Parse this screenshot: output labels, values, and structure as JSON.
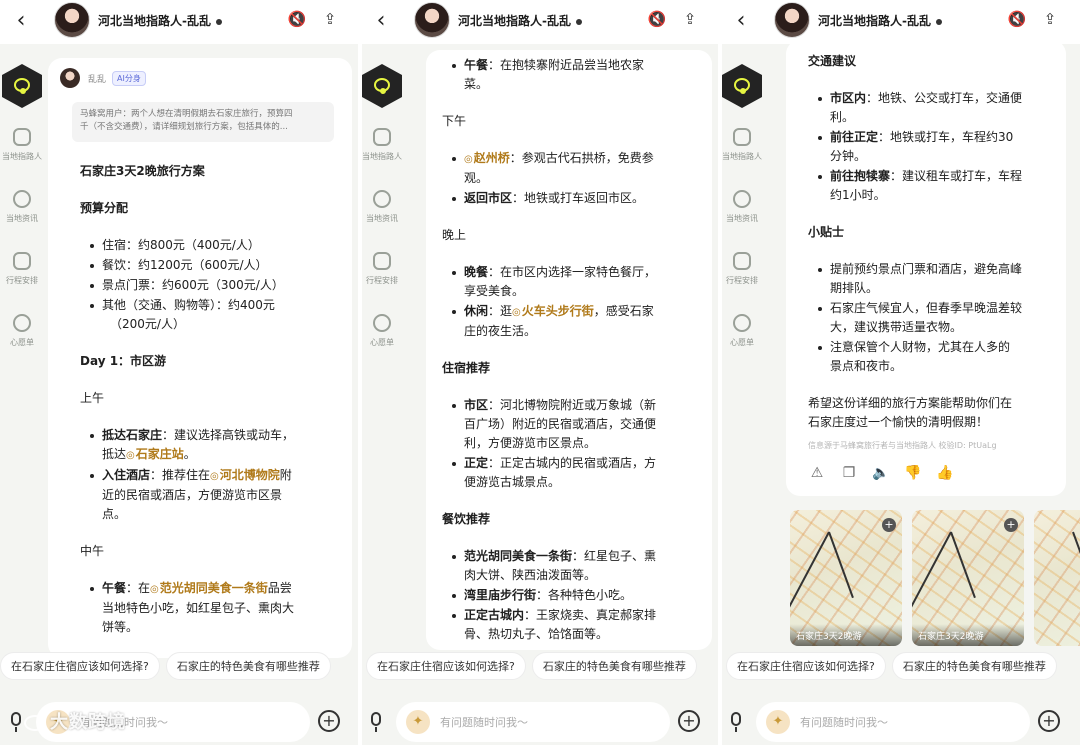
{
  "header": {
    "title": "河北当地指路人-乱乱",
    "back_icon": "chevron-left-icon",
    "mute_icon": "speaker-mute-icon",
    "share_icon": "share-icon"
  },
  "sidebar": {
    "items": [
      {
        "label": "当地指路人",
        "icon": "guide-icon"
      },
      {
        "label": "当地资讯",
        "icon": "news-icon"
      },
      {
        "label": "行程安排",
        "icon": "itinerary-icon"
      },
      {
        "label": "心愿单",
        "icon": "wishlist-icon"
      }
    ]
  },
  "message": {
    "sender": "乱乱",
    "badge": "AI分身",
    "quote_line1": "马蜂窝用户：两个人想在清明假期去石家庄旅行，预算四",
    "quote_line2": "千（不含交通费），请详细规划旅行方案，包括具体的..."
  },
  "panel1": {
    "title": "石家庄3天2晚旅行方案",
    "budget_heading": "预算分配",
    "budget": [
      "住宿：约800元（400元/人）",
      "餐饮：约1200元（600元/人）",
      "景点门票：约600元（300元/人）",
      "其他（交通、购物等）：约400元"
    ],
    "budget_last_cont": "（200元/人）",
    "day1": "Day 1：市区游",
    "morning": "上午",
    "m1_bold": "抵达石家庄",
    "m1_text": "：建议选择高铁或动车，",
    "m1_text2": "抵达",
    "m1_loc": "石家庄站",
    "m1_end": "。",
    "m2_bold": "入住酒店",
    "m2_text": "：推荐住在",
    "m2_loc": "河北博物院",
    "m2_text2": "附",
    "m2_text3": "近的民宿或酒店，方便游览市区景",
    "m2_text4": "点。",
    "noon": "中午",
    "n1_bold": "午餐",
    "n1_text": "：在",
    "n1_loc": "范光胡同美食一条街",
    "n1_text2": "品尝",
    "n1_text3": "当地特色小吃，如红星包子、熏肉大",
    "n1_text4": "饼等。"
  },
  "panel2": {
    "a1_bold": "午餐",
    "a1_text": "：在抱犊寨附近品尝当地农家",
    "a1_text2": "菜。",
    "afternoon": "下午",
    "b1_loc": "赵州桥",
    "b1_text": "：参观古代石拱桥，免费参",
    "b1_text2": "观。",
    "b2_bold": "返回市区",
    "b2_text": "：地铁或打车返回市区。",
    "evening": "晚上",
    "c1_bold": "晚餐",
    "c1_text": "：在市区内选择一家特色餐厅，",
    "c1_text2": "享受美食。",
    "c2_bold": "休闲",
    "c2_text": "：逛",
    "c2_loc": "火车头步行街",
    "c2_text2": "，感受石家",
    "c2_text3": "庄的夜生活。",
    "stay_heading": "住宿推荐",
    "s1_bold": "市区",
    "s1_text": "：河北博物院附近或万象城（新",
    "s1_text2": "百广场）附近的民宿或酒店，交通便",
    "s1_text3": "利，方便游览市区景点。",
    "s2_bold": "正定",
    "s2_text": "：正定古城内的民宿或酒店，方",
    "s2_text2": "便游览古城景点。",
    "food_heading": "餐饮推荐",
    "f1_bold": "范光胡同美食一条街",
    "f1_text": "：红星包子、熏",
    "f1_text2": "肉大饼、陕西油泼面等。",
    "f2_bold": "湾里庙步行街",
    "f2_text": "：各种特色小吃。",
    "f3_bold": "正定古城内",
    "f3_text": "：王家烧卖、真定郝家排",
    "f3_text2": "骨、热切丸子、饸饹面等。"
  },
  "panel3": {
    "traffic_heading": "交通建议",
    "t1_bold": "市区内",
    "t1_text": "：地铁、公交或打车，交通便",
    "t1_text2": "利。",
    "t2_bold": "前往正定",
    "t2_text": "：地铁或打车，车程约30",
    "t2_text2": "分钟。",
    "t3_bold": "前往抱犊寨",
    "t3_text": "：建议租车或打车，车程",
    "t3_text2": "约1小时。",
    "tips_heading": "小贴士",
    "tips": [
      "提前预约景点门票和酒店，避免高峰",
      "石家庄气候宜人，但春季早晚温差较",
      "注意保管个人财物，尤其在人多的"
    ],
    "tips_cont": [
      "期排队。",
      "大，建议携带适量衣物。",
      "景点和夜市。"
    ],
    "closing1": "希望这份详细的旅行方案能帮助你们在",
    "closing2": "石家庄度过一个愉快的清明假期！",
    "source": "信息源于马蜂窝旅行者与当地指路人 校验ID: PtUaLg",
    "map_caption": "石家庄3天2晚游",
    "map_caption2": "石家庄3天2晚游"
  },
  "chips": [
    "在石家庄住宿应该如何选择?",
    "石家庄的特色美食有哪些推荐"
  ],
  "input": {
    "placeholder": "有问题随时问我～"
  },
  "watermark": "大数跨境"
}
